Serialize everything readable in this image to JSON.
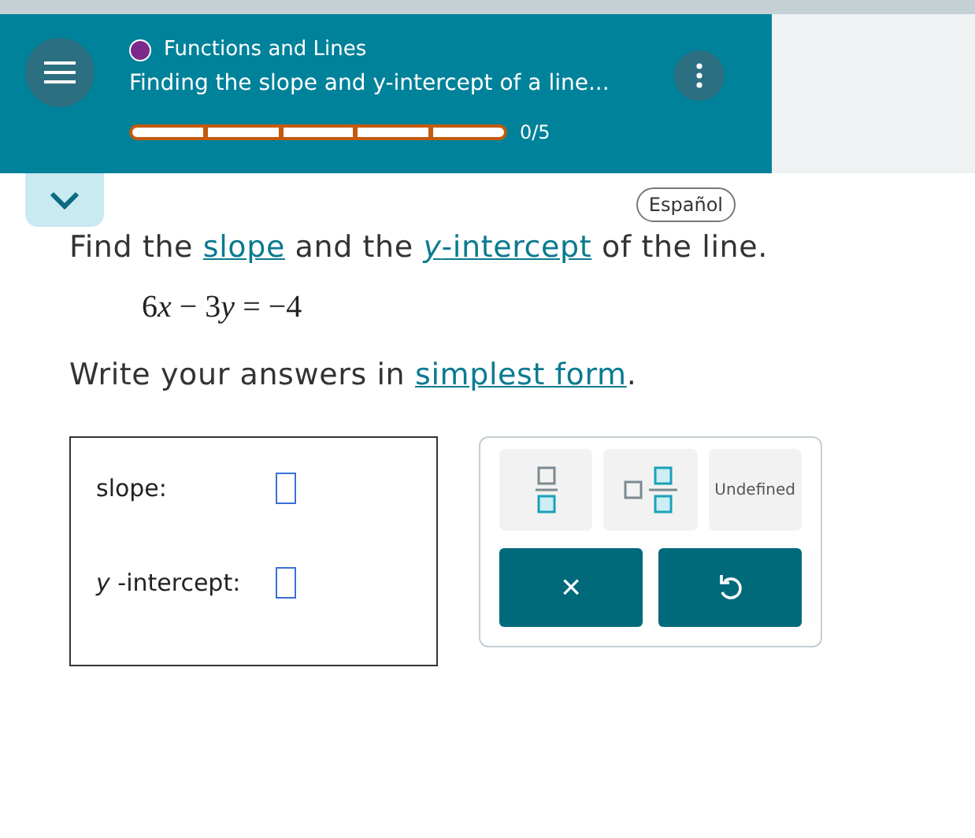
{
  "header": {
    "topic": {
      "label": "Functions and Lines",
      "color": "#7b2a8c"
    },
    "title": "Finding the slope and y-intercept of a line...",
    "progress": {
      "segments": [
        {
          "filled": false
        },
        {
          "filled": false
        },
        {
          "filled": false
        },
        {
          "filled": false
        },
        {
          "filled": false
        }
      ],
      "label": "0/5"
    }
  },
  "language_button": "Español",
  "question": [
    {
      "kind": "text",
      "text": "Find the "
    },
    {
      "kind": "link",
      "text": "slope"
    },
    {
      "kind": "text",
      "text": " and the "
    },
    {
      "kind": "link",
      "text": "*y*-intercept"
    },
    {
      "kind": "text",
      "text": " of the line."
    }
  ],
  "equation": [
    {
      "kind": "num",
      "text": "6"
    },
    {
      "kind": "var",
      "text": "x"
    },
    {
      "kind": "num",
      "text": " − 3"
    },
    {
      "kind": "var",
      "text": "y"
    },
    {
      "kind": "num",
      "text": " = −4"
    }
  ],
  "instruction": [
    {
      "kind": "text",
      "text": "Write your answers in "
    },
    {
      "kind": "link",
      "text": "simplest form"
    },
    {
      "kind": "text",
      "text": "."
    }
  ],
  "answers": [
    {
      "label": "slope:"
    },
    {
      "label": "*y* -intercept:"
    }
  ],
  "keypad": [
    {
      "kind": "fraction"
    },
    {
      "kind": "mixed"
    },
    {
      "kind": "text",
      "text": "Undefined"
    }
  ],
  "actions": [
    {
      "kind": "clear",
      "text": "×"
    },
    {
      "kind": "undo"
    }
  ]
}
